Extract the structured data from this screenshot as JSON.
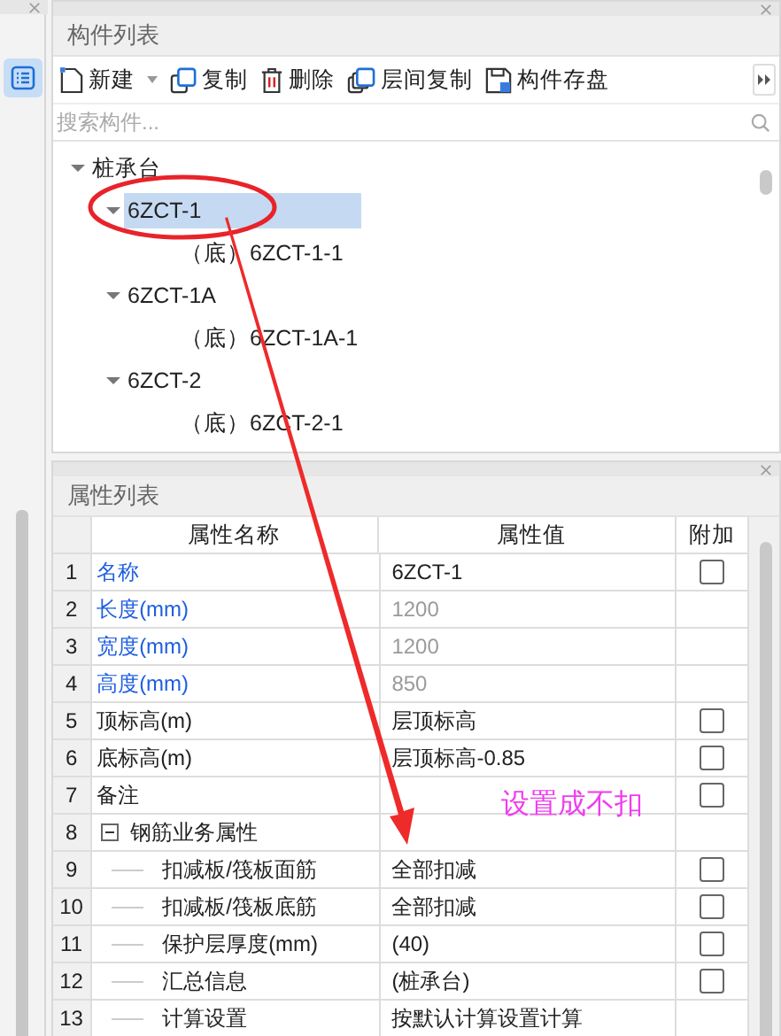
{
  "component_panel": {
    "title": "构件列表",
    "toolbar": [
      {
        "label": "新建",
        "kind": "new",
        "dropdown": true
      },
      {
        "label": "复制",
        "kind": "copy",
        "dropdown": false
      },
      {
        "label": "删除",
        "kind": "delete",
        "dropdown": false
      },
      {
        "label": "层间复制",
        "kind": "floor-copy",
        "dropdown": false
      },
      {
        "label": "构件存盘",
        "kind": "save",
        "dropdown": false
      }
    ],
    "search": {
      "placeholder": "搜索构件..."
    },
    "tree": [
      {
        "label": "桩承台",
        "expanded": true,
        "selected": false,
        "children": [
          {
            "label": "6ZCT-1",
            "expanded": true,
            "selected": true,
            "children": [
              {
                "label": "（底）6ZCT-1-1",
                "selected": false
              }
            ]
          },
          {
            "label": "6ZCT-1A",
            "expanded": true,
            "selected": false,
            "children": [
              {
                "label": "（底）6ZCT-1A-1",
                "selected": false
              }
            ]
          },
          {
            "label": "6ZCT-2",
            "expanded": true,
            "selected": false,
            "children": [
              {
                "label": "（底）6ZCT-2-1",
                "selected": false
              }
            ]
          }
        ]
      }
    ]
  },
  "property_panel": {
    "title": "属性列表",
    "columns": [
      "属性名称",
      "属性值",
      "附加"
    ],
    "rows": [
      {
        "number": "1",
        "name": "名称",
        "value": "6ZCT-1",
        "public": true,
        "readonly": false,
        "checked": false
      },
      {
        "number": "2",
        "name": "长度(mm)",
        "value": "1200",
        "public": true,
        "readonly": true
      },
      {
        "number": "3",
        "name": "宽度(mm)",
        "value": "1200",
        "public": true,
        "readonly": true
      },
      {
        "number": "4",
        "name": "高度(mm)",
        "value": "850",
        "public": true,
        "readonly": true
      },
      {
        "number": "5",
        "name": "顶标高(m)",
        "value": "层顶标高",
        "public": false,
        "readonly": false,
        "checked": false
      },
      {
        "number": "6",
        "name": "底标高(m)",
        "value": "层顶标高-0.85",
        "public": false,
        "readonly": false,
        "checked": false
      },
      {
        "number": "7",
        "name": "备注",
        "public": false,
        "checked": false
      },
      {
        "number": "8",
        "name": "钢筋业务属性",
        "kind": "group",
        "expanded": true,
        "public": false,
        "children": [
          {
            "number": "9",
            "name": "扣减板/筏板面筋",
            "value": "全部扣减",
            "public": false,
            "readonly": false,
            "checked": false
          },
          {
            "number": "10",
            "name": "扣减板/筏板底筋",
            "value": "全部扣减",
            "public": false,
            "readonly": false,
            "checked": false
          },
          {
            "number": "11",
            "name": "保护层厚度(mm)",
            "value": "(40)",
            "public": false,
            "readonly": false,
            "checked": false
          },
          {
            "number": "12",
            "name": "汇总信息",
            "value": "(桩承台)",
            "public": false,
            "readonly": false,
            "checked": false
          },
          {
            "number": "13",
            "name": "计算设置",
            "value": "按默认计算设置计算",
            "public": false,
            "readonly": false
          }
        ]
      }
    ]
  },
  "annotation": {
    "text": "设置成不扣"
  }
}
